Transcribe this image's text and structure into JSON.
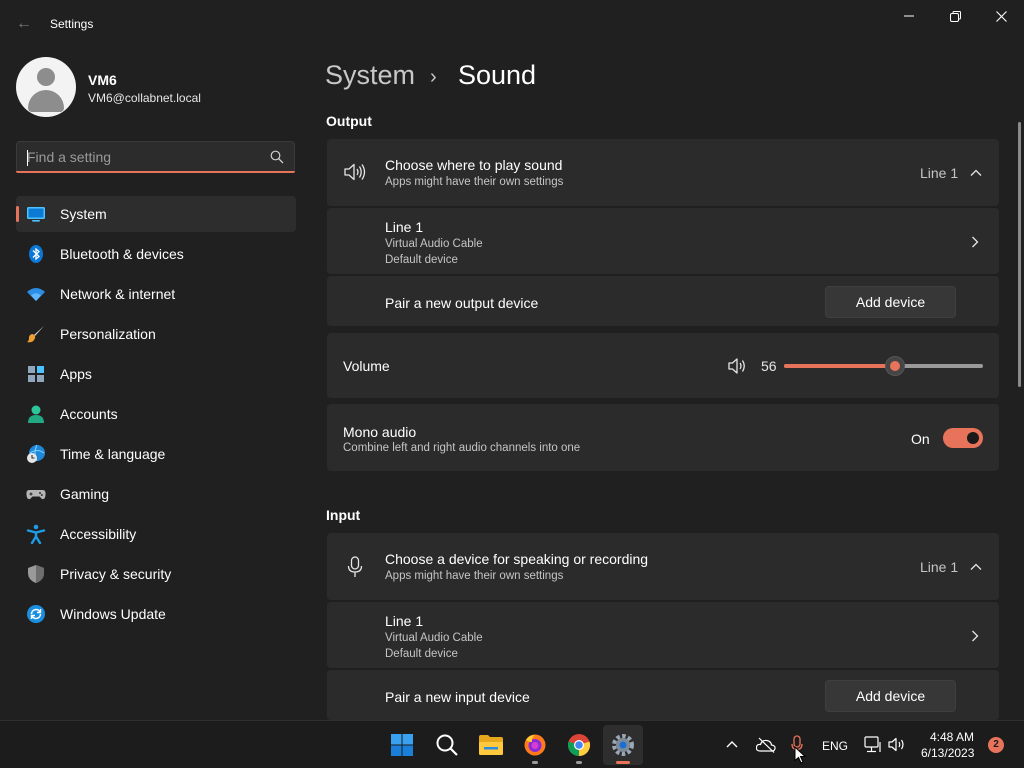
{
  "window": {
    "title": "Settings",
    "back_glyph": "←"
  },
  "profile": {
    "name": "VM6",
    "email": "VM6@collabnet.local"
  },
  "search": {
    "placeholder": "Find a setting"
  },
  "nav": {
    "items": [
      {
        "label": "System",
        "icon": "system-icon",
        "active": true
      },
      {
        "label": "Bluetooth & devices",
        "icon": "bluetooth-icon"
      },
      {
        "label": "Network & internet",
        "icon": "wifi-icon"
      },
      {
        "label": "Personalization",
        "icon": "brush-icon"
      },
      {
        "label": "Apps",
        "icon": "apps-icon"
      },
      {
        "label": "Accounts",
        "icon": "accounts-icon"
      },
      {
        "label": "Time & language",
        "icon": "time-language-icon"
      },
      {
        "label": "Gaming",
        "icon": "gamepad-icon"
      },
      {
        "label": "Accessibility",
        "icon": "accessibility-icon"
      },
      {
        "label": "Privacy & security",
        "icon": "shield-icon"
      },
      {
        "label": "Windows Update",
        "icon": "windows-update-icon"
      }
    ]
  },
  "breadcrumb": {
    "root": "System",
    "separator": "›",
    "current": "Sound"
  },
  "output": {
    "section_title": "Output",
    "choose": {
      "title": "Choose where to play sound",
      "subtitle": "Apps might have their own settings",
      "value": "Line 1"
    },
    "device": {
      "name": "Line 1",
      "type": "Virtual Audio Cable",
      "status": "Default device"
    },
    "pair": {
      "label": "Pair a new output device",
      "button": "Add device"
    }
  },
  "volume": {
    "label": "Volume",
    "value": "56",
    "level": 0.56
  },
  "mono": {
    "title": "Mono audio",
    "subtitle": "Combine left and right audio channels into one",
    "state": "On",
    "on": true
  },
  "input": {
    "section_title": "Input",
    "choose": {
      "title": "Choose a device for speaking or recording",
      "subtitle": "Apps might have their own settings",
      "value": "Line 1"
    },
    "device": {
      "name": "Line 1",
      "type": "Virtual Audio Cable",
      "status": "Default device"
    },
    "pair": {
      "label": "Pair a new input device",
      "button": "Add device"
    }
  },
  "taskbar": {
    "apps": [
      "start-icon",
      "search-icon",
      "file-explorer-icon",
      "firefox-icon",
      "chrome-icon",
      "settings-icon"
    ],
    "language": "ENG",
    "time": "4:48 AM",
    "date": "6/13/2023",
    "notifications": "2"
  },
  "colors": {
    "accent": "#e8735b",
    "background": "#202020",
    "card": "#2b2b2b"
  }
}
